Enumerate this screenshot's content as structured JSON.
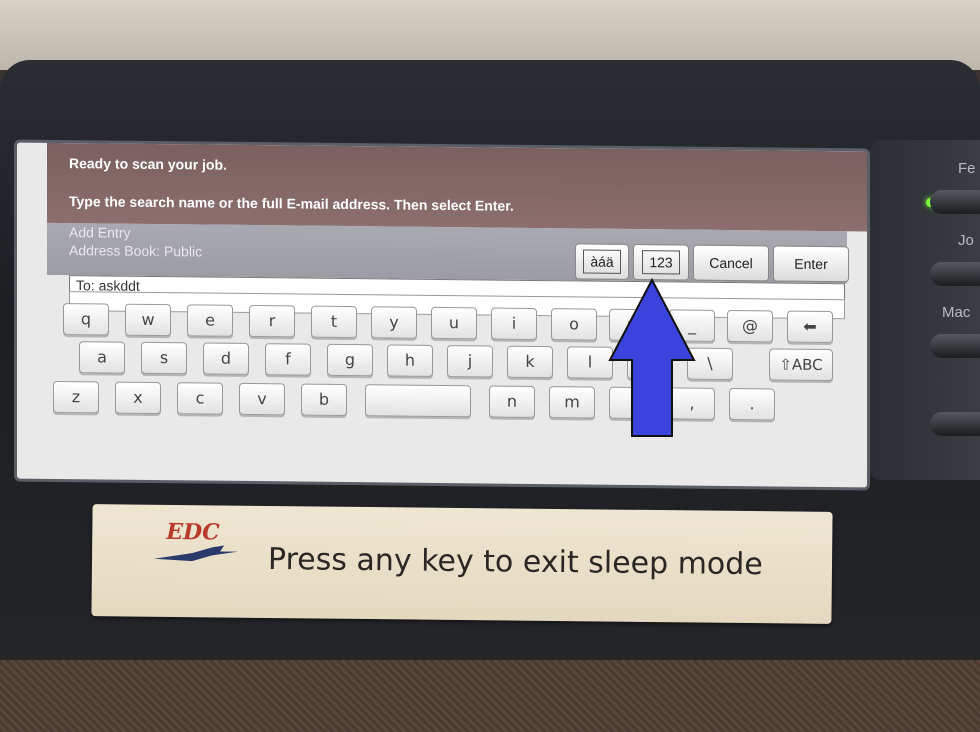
{
  "status": {
    "message": "Ready to scan your job.",
    "instruction": "Type the search name or the full E-mail address. Then select Enter."
  },
  "entry": {
    "title": "Add Entry",
    "address_book": "Address Book: Public"
  },
  "buttons": {
    "accents": "àáä",
    "numeric": "123",
    "cancel": "Cancel",
    "enter": "Enter"
  },
  "to_field": {
    "value": "To: askddt"
  },
  "keyboard": {
    "row1": [
      "q",
      "w",
      "e",
      "r",
      "t",
      "y",
      "u",
      "i",
      "o",
      "p",
      "_",
      "@",
      "⬅"
    ],
    "row2": [
      "a",
      "s",
      "d",
      "f",
      "g",
      "h",
      "j",
      "k",
      "l",
      ";",
      "\\",
      "⇧ABC"
    ],
    "row3": [
      "z",
      "x",
      "c",
      "v",
      "b",
      " ",
      "n",
      "m",
      ",",
      ",",
      "."
    ]
  },
  "side_panel": {
    "labels": [
      "Fe",
      "Jo",
      "Mac"
    ]
  },
  "sticker": {
    "logo": "EDC",
    "message": "Press any key to exit sleep mode"
  },
  "colors": {
    "status_bar": "#8c6e6e",
    "arrow": "#3a44dd"
  }
}
